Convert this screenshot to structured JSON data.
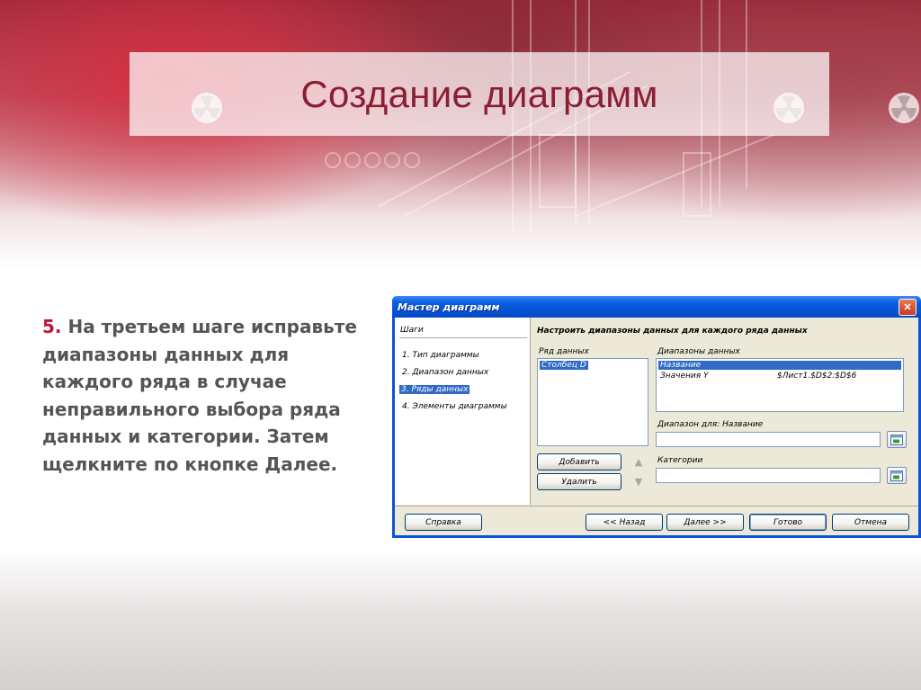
{
  "slide": {
    "title": "Создание диаграмм",
    "step_number": "5.",
    "body_text": "На третьем шаге исправьте диапазоны данных для каждого ряда в случае неправильного выбора ряда данных и категории. Затем щелкните по кнопке Далее."
  },
  "dialog": {
    "title": "Мастер диаграмм",
    "close_symbol": "✕",
    "steps_header": "Шаги",
    "steps": [
      "1. Тип диаграммы",
      "2. Диапазон данных",
      "3. Ряды данных",
      "4. Элементы диаграммы"
    ],
    "active_step_index": 2,
    "main_heading": "Настроить диапазоны данных для каждого ряда данных",
    "series_label": "Ряд данных",
    "series_items": [
      "Столбец D"
    ],
    "ranges_label": "Диапазоны данных",
    "ranges": [
      {
        "name": "Название",
        "value": ""
      },
      {
        "name": "Значения Y",
        "value": "$Лист1.$D$2:$D$6"
      }
    ],
    "range_for_label": "Диапазон для: Название",
    "range_for_value": "",
    "categories_label": "Категории",
    "categories_value": "",
    "buttons": {
      "add": "Добавить",
      "remove": "Удалить",
      "help": "Справка",
      "back": "<< Назад",
      "next": "Далее >>",
      "finish": "Готово",
      "cancel": "Отмена"
    },
    "icons": {
      "up": "up-arrow-icon",
      "down": "down-arrow-icon",
      "picker": "range-picker-icon"
    }
  },
  "colors": {
    "title": "#8a1e33",
    "step_number": "#c2123a",
    "body_text": "#555555",
    "dialog_blue": "#0a53d6",
    "selection": "#316ac5"
  }
}
